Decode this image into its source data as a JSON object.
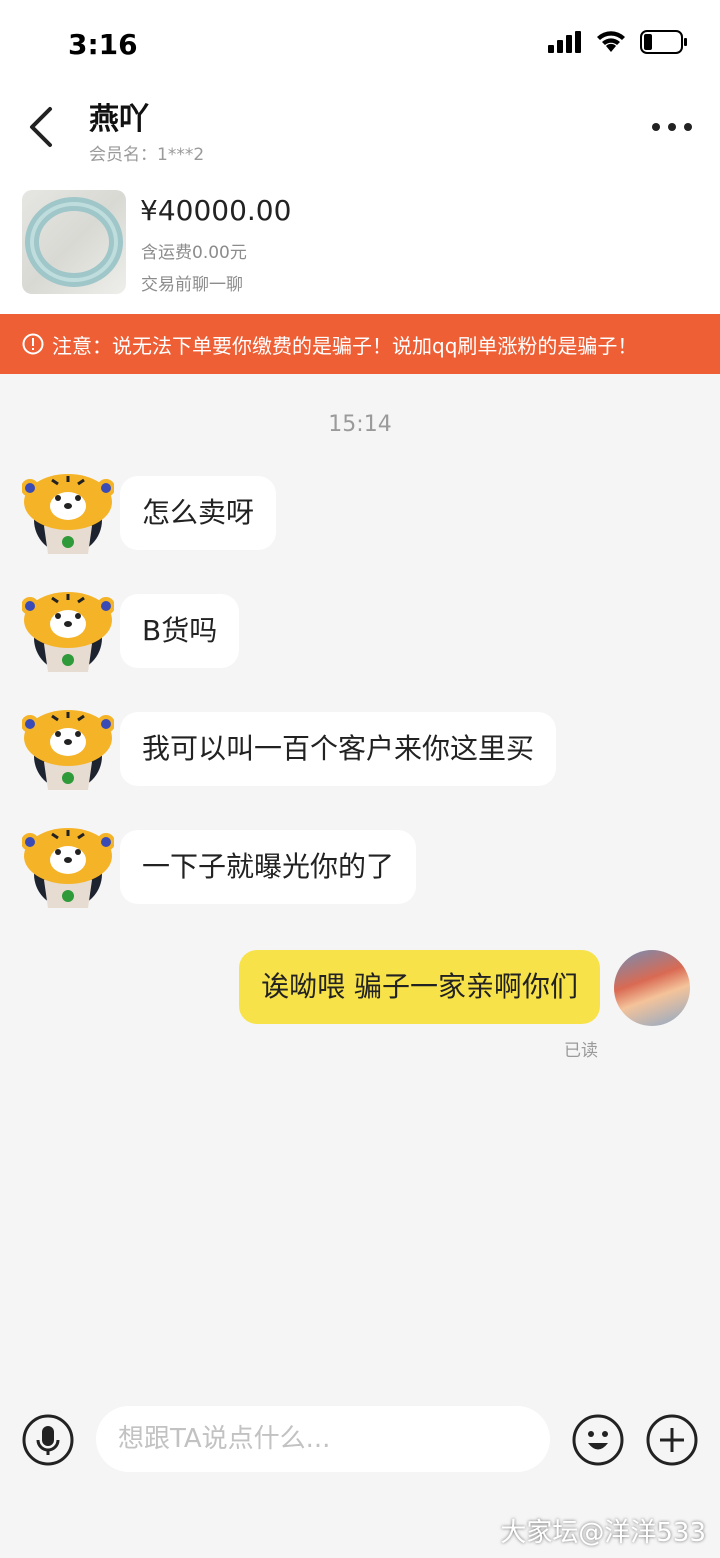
{
  "status_bar": {
    "time": "3:16"
  },
  "header": {
    "contact_name": "燕吖",
    "member_label": "会员名：1***2"
  },
  "product": {
    "price": "¥40000.00",
    "shipping": "含运费0.00元",
    "chat_hint": "交易前聊一聊"
  },
  "warning": {
    "text": "注意：说无法下单要你缴费的是骗子！说加qq刷单涨粉的是骗子！"
  },
  "chat": {
    "timestamp": "15:14",
    "incoming": [
      {
        "text": "怎么卖呀"
      },
      {
        "text": "B货吗"
      },
      {
        "text": "我可以叫一百个客户来你这里买"
      },
      {
        "text": "一下子就曝光你的了"
      }
    ],
    "outgoing": [
      {
        "text": "诶呦喂 骗子一家亲啊你们"
      }
    ],
    "read_status": "已读"
  },
  "input": {
    "placeholder": "想跟TA说点什么..."
  },
  "watermark": "大家坛@洋洋533",
  "colors": {
    "warning_bg": "#ee5f36",
    "my_bubble": "#f7e24a",
    "background": "#f5f5f5"
  }
}
